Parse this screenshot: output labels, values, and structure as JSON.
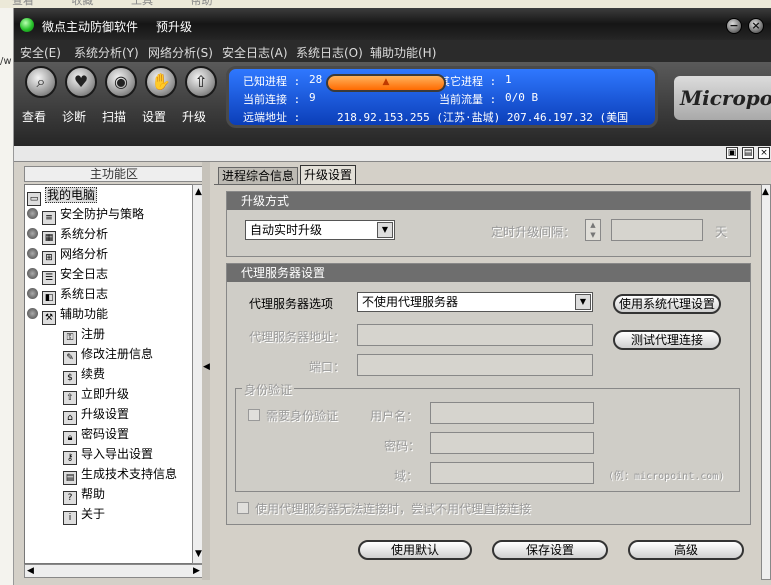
{
  "host": {
    "menu": [
      "查看",
      "收藏",
      "工具",
      "帮助"
    ],
    "address_fragment": "/w"
  },
  "window": {
    "title": "微点主动防御软件",
    "subtitle": "预升级",
    "buttons": [
      "−",
      "×"
    ]
  },
  "menubar": [
    "安全(E)",
    "系统分析(Y)",
    "网络分析(S)",
    "安全日志(A)",
    "系统日志(O)",
    "辅助功能(H)"
  ],
  "toolbar": {
    "tools": [
      {
        "label": "查看",
        "icon": "magnifier-icon"
      },
      {
        "label": "诊断",
        "icon": "diagnose-icon"
      },
      {
        "label": "扫描",
        "icon": "scan-icon"
      },
      {
        "label": "设置",
        "icon": "settings-hand-icon"
      },
      {
        "label": "升级",
        "icon": "upgrade-icon"
      }
    ],
    "status": {
      "known_proc_label": "已知进程 :",
      "known_proc_value": "28",
      "other_proc_label": "其它进程 :",
      "other_proc_value": "1",
      "conn_label": "当前连接 :",
      "conn_value": "9",
      "traffic_label": "当前流量 :",
      "traffic_value": "0/0 B",
      "remote_label": "远端地址 :",
      "remote_value": "218.92.153.255 (江苏·盐城)    207.46.197.32 (美国"
    },
    "brand": "Micropoint"
  },
  "nav": {
    "header": "主功能区",
    "items": [
      {
        "label": "我的电脑",
        "level": 0
      },
      {
        "label": "安全防护与策略",
        "level": 1
      },
      {
        "label": "系统分析",
        "level": 1
      },
      {
        "label": "网络分析",
        "level": 1
      },
      {
        "label": "安全日志",
        "level": 1
      },
      {
        "label": "系统日志",
        "level": 1
      },
      {
        "label": "辅助功能",
        "level": 1
      },
      {
        "label": "注册",
        "level": 2
      },
      {
        "label": "修改注册信息",
        "level": 2
      },
      {
        "label": "续费",
        "level": 2
      },
      {
        "label": "立即升级",
        "level": 2
      },
      {
        "label": "升级设置",
        "level": 2
      },
      {
        "label": "密码设置",
        "level": 2
      },
      {
        "label": "导入导出设置",
        "level": 2
      },
      {
        "label": "生成技术支持信息",
        "level": 2
      },
      {
        "label": "帮助",
        "level": 2
      },
      {
        "label": "关于",
        "level": 2
      }
    ]
  },
  "tabs": [
    {
      "label": "进程综合信息",
      "active": false
    },
    {
      "label": "升级设置",
      "active": true
    }
  ],
  "upgrade_mode": {
    "heading": "升级方式",
    "mode_value": "自动实时升级",
    "interval_label": "定时升级间隔：",
    "interval_value": "",
    "interval_unit": "天"
  },
  "proxy": {
    "heading": "代理服务器设置",
    "option_label": "代理服务器选项",
    "option_value": "不使用代理服务器",
    "address_label": "代理服务器地址：",
    "port_label": "端口：",
    "auth_legend": "身份验证",
    "need_auth_label": "需要身份验证",
    "user_label": "用户名：",
    "password_label": "密码：",
    "domain_label": "域：",
    "domain_example": "(例：micropoint.com)",
    "fallback_label": "使用代理服务器无法连接时，尝试不用代理直接连接",
    "system_proxy_button": "使用系统代理设置",
    "test_button": "测试代理连接"
  },
  "footer": {
    "default_button": "使用默认",
    "save_button": "保存设置",
    "advanced_button": "高级"
  },
  "subbar_icons": [
    "▣",
    "▤",
    "×"
  ]
}
